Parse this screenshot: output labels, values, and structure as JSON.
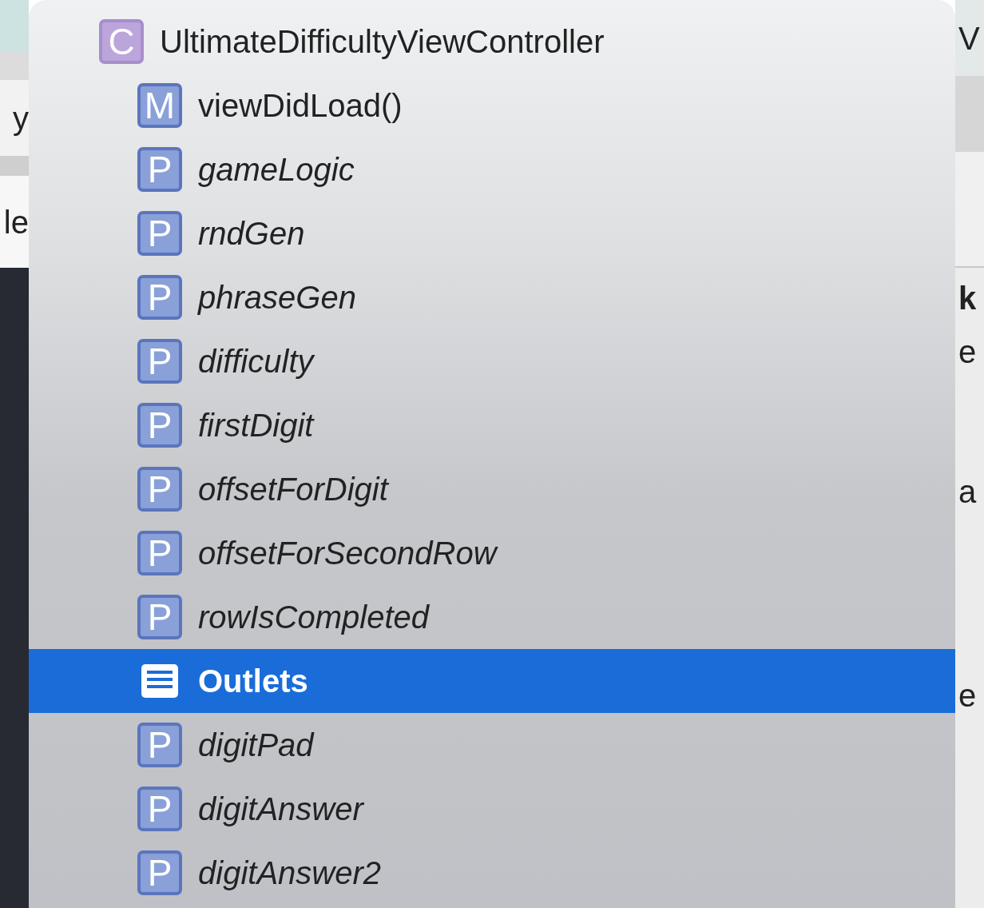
{
  "left_fragments": [
    {
      "text": "y"
    },
    {
      "text": "le"
    }
  ],
  "right_fragments": [
    {
      "text": "V",
      "kind": "plain"
    },
    {
      "text": "k",
      "kind": "heading"
    },
    {
      "text": "e",
      "kind": "plain"
    },
    {
      "text": "a",
      "kind": "plain"
    },
    {
      "text": "e",
      "kind": "plain"
    }
  ],
  "menu": {
    "header": {
      "badge": "C",
      "label": "UltimateDifficultyViewController"
    },
    "items": [
      {
        "kind": "method",
        "badge": "M",
        "label": "viewDidLoad()",
        "selected": false
      },
      {
        "kind": "property",
        "badge": "P",
        "label": "gameLogic",
        "selected": false
      },
      {
        "kind": "property",
        "badge": "P",
        "label": "rndGen",
        "selected": false
      },
      {
        "kind": "property",
        "badge": "P",
        "label": "phraseGen",
        "selected": false
      },
      {
        "kind": "property",
        "badge": "P",
        "label": "difficulty",
        "selected": false
      },
      {
        "kind": "property",
        "badge": "P",
        "label": "firstDigit",
        "selected": false
      },
      {
        "kind": "property",
        "badge": "P",
        "label": "offsetForDigit",
        "selected": false
      },
      {
        "kind": "property",
        "badge": "P",
        "label": "offsetForSecondRow",
        "selected": false
      },
      {
        "kind": "property",
        "badge": "P",
        "label": "rowIsCompleted",
        "selected": false
      },
      {
        "kind": "group",
        "label": "Outlets",
        "selected": true
      },
      {
        "kind": "property",
        "badge": "P",
        "label": "digitPad",
        "selected": false
      },
      {
        "kind": "property",
        "badge": "P",
        "label": "digitAnswer",
        "selected": false
      },
      {
        "kind": "property",
        "badge": "P",
        "label": "digitAnswer2",
        "selected": false
      }
    ]
  }
}
